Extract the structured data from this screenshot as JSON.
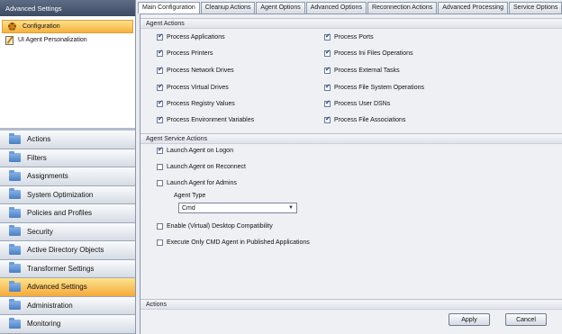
{
  "sidebar": {
    "header": "Advanced Settings",
    "tree": [
      {
        "label": "Configuration",
        "icon": "gear-icon",
        "selected": true
      },
      {
        "label": "UI Agent Personalization",
        "icon": "pencil-icon",
        "selected": false
      }
    ],
    "nav": [
      {
        "label": "Actions",
        "active": false
      },
      {
        "label": "Filters",
        "active": false
      },
      {
        "label": "Assignments",
        "active": false
      },
      {
        "label": "System Optimization",
        "active": false
      },
      {
        "label": "Policies and Profiles",
        "active": false
      },
      {
        "label": "Security",
        "active": false
      },
      {
        "label": "Active Directory Objects",
        "active": false
      },
      {
        "label": "Transformer Settings",
        "active": false
      },
      {
        "label": "Advanced Settings",
        "active": true
      },
      {
        "label": "Administration",
        "active": false
      },
      {
        "label": "Monitoring",
        "active": false
      }
    ]
  },
  "tabs": [
    {
      "label": "Main Configuration",
      "active": true
    },
    {
      "label": "Cleanup Actions",
      "active": false
    },
    {
      "label": "Agent Options",
      "active": false
    },
    {
      "label": "Advanced Options",
      "active": false
    },
    {
      "label": "Reconnection Actions",
      "active": false
    },
    {
      "label": "Advanced Processing",
      "active": false
    },
    {
      "label": "Service Options",
      "active": false
    }
  ],
  "tab_scroll_glyph": "◂",
  "agent_actions": {
    "title": "Agent Actions",
    "left": [
      {
        "label": "Process Applications",
        "checked": true
      },
      {
        "label": "Process Printers",
        "checked": true
      },
      {
        "label": "Process Network Drives",
        "checked": true
      },
      {
        "label": "Process Virtual Drives",
        "checked": true
      },
      {
        "label": "Process Registry Values",
        "checked": true
      },
      {
        "label": "Process Environment Variables",
        "checked": true
      }
    ],
    "right": [
      {
        "label": "Process Ports",
        "checked": true
      },
      {
        "label": "Process Ini Files Operations",
        "checked": true
      },
      {
        "label": "Process External Tasks",
        "checked": true
      },
      {
        "label": "Process File System Operations",
        "checked": true
      },
      {
        "label": "Process User DSNs",
        "checked": true
      },
      {
        "label": "Process File Associations",
        "checked": true
      }
    ]
  },
  "agent_service_actions": {
    "title": "Agent Service Actions",
    "items_top": [
      {
        "label": "Launch Agent on Logon",
        "checked": true
      },
      {
        "label": "Launch Agent on Reconnect",
        "checked": false
      },
      {
        "label": "Launch Agent for Admins",
        "checked": false
      }
    ],
    "agent_type_label": "Agent Type",
    "agent_type_value": "Cmd",
    "items_bottom": [
      {
        "label": "Enable (Virtual) Desktop Compatibility",
        "checked": false
      },
      {
        "label": "Execute Only CMD Agent in Published Applications",
        "checked": false
      }
    ]
  },
  "actions_section": {
    "title": "Actions",
    "apply_label": "Apply",
    "cancel_label": "Cancel"
  }
}
